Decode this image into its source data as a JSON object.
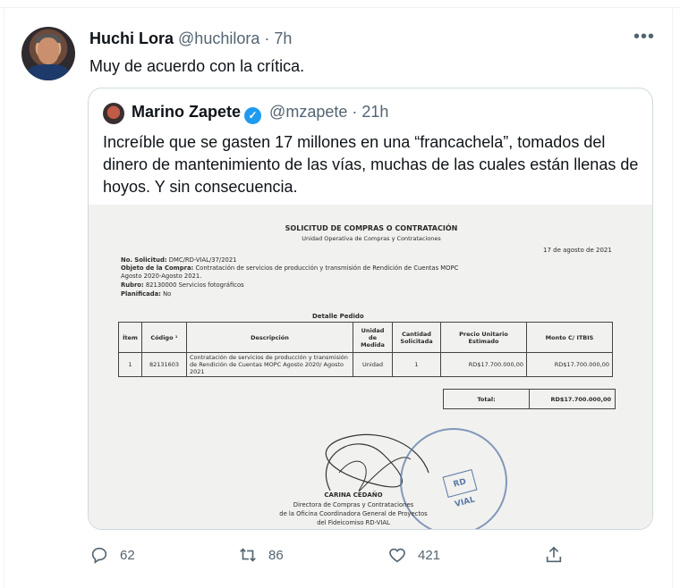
{
  "tweet": {
    "name": "Huchi Lora",
    "handle": "@huchilora",
    "separator": "·",
    "time": "7h",
    "text": "Muy de acuerdo con la crítica.",
    "more_icon": "more-icon"
  },
  "quote": {
    "name": "Marino Zapete",
    "handle": "@mzapete",
    "separator": "·",
    "time": "21h",
    "text": "Increíble que se gasten 17 millones en una “francachela”, tomados del dinero de mantenimiento de las vías, muchas de las cuales están llenas de hoyos. Y sin consecuencia.",
    "verified_color": "#1d9bf0"
  },
  "document": {
    "title": "SOLICITUD DE COMPRAS O CONTRATACIÓN",
    "subtitle": "Unidad Operativa de Compras y Contrataciones",
    "date": "17 de agosto de 2021",
    "solicitud_label": "No. Solicitud:",
    "solicitud_value": "DMC/RD-VIAL/37/2021",
    "objeto_label": "Objeto de la Compra:",
    "objeto_value": "Contratación de servicios de producción y transmisión de Rendición de Cuentas MOPC Agosto 2020-Agosto 2021.",
    "rubro_label": "Rubro:",
    "rubro_value": "82130000 Servicios fotográficos",
    "planificada_label": "Planificada:",
    "planificada_value": "No",
    "detail_title": "Detalle Pedido",
    "columns": [
      "Ítem",
      "Código ¹",
      "Descripción",
      "Unidad de Medida",
      "Cantidad Solicitada",
      "Precio Unitario Estimado",
      "Monto C/ ITBIS"
    ],
    "row": {
      "item": "1",
      "codigo": "82131603",
      "descripcion": "Contratación de servicios de producción y transmisión de Rendición de Cuentas MOPC Agosto 2020/ Agosto 2021",
      "unidad": "Unidad",
      "cantidad": "1",
      "precio": "RD$17.700.000,00",
      "monto": "RD$17.700.000,00"
    },
    "total_label": "Total:",
    "total_value": "RD$17.700.000,00",
    "signer_name": "CARINA CEDAÑO",
    "signer_line1": "Directora de Compras y Contrataciones",
    "signer_line2": "de la Oficina Coordinadora General de Proyectos",
    "signer_line3": "del Fideicomiso RD-VIAL",
    "stamp_text": "RD VIAL"
  },
  "actions": {
    "reply_count": "62",
    "retweet_count": "86",
    "like_count": "421"
  }
}
